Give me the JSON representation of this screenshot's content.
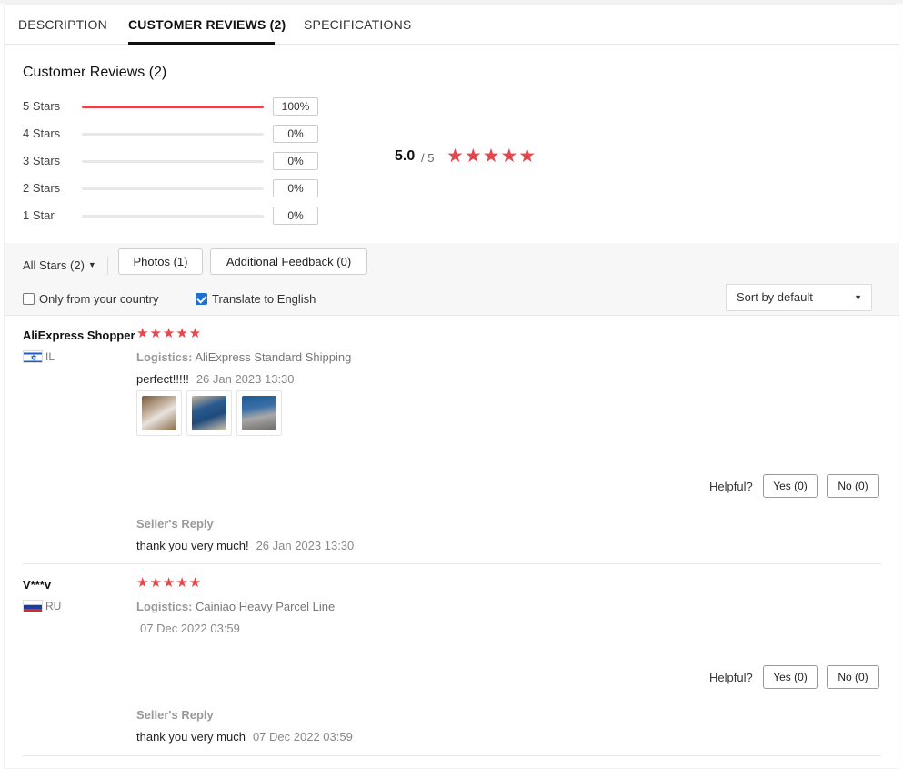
{
  "tabs": [
    {
      "label": "DESCRIPTION"
    },
    {
      "label": "CUSTOMER REVIEWS (2)"
    },
    {
      "label": "SPECIFICATIONS"
    }
  ],
  "summary": {
    "title": "Customer Reviews (2)",
    "distribution": [
      {
        "label": "5 Stars",
        "pct": "100%",
        "fill": 1.0
      },
      {
        "label": "4 Stars",
        "pct": "0%",
        "fill": 0
      },
      {
        "label": "3 Stars",
        "pct": "0%",
        "fill": 0
      },
      {
        "label": "2 Stars",
        "pct": "0%",
        "fill": 0
      },
      {
        "label": "1 Star",
        "pct": "0%",
        "fill": 0
      }
    ],
    "score": "5.0",
    "score_total": "/ 5",
    "stars": "★★★★★",
    "accent_color": "#e5474c"
  },
  "filters": {
    "all_stars": "All Stars (2)",
    "photos": "Photos (1)",
    "additional_feedback": "Additional Feedback (0)",
    "only_country": "Only from your country",
    "translate": "Translate to English",
    "translate_checked": true,
    "only_country_checked": false,
    "sort": "Sort by default"
  },
  "reviews": [
    {
      "name": "AliExpress Shopper",
      "country": "IL",
      "stars": "★★★★★",
      "logistics_label": "Logistics:",
      "logistics": "AliExpress Standard Shipping",
      "text": "perfect!!!!!",
      "date": "26 Jan 2023 13:30",
      "photos": 3,
      "helpful_label": "Helpful?",
      "yes": "Yes (0)",
      "no": "No (0)",
      "reply_title": "Seller's Reply",
      "reply_text": "thank you very much!",
      "reply_date": "26 Jan 2023 13:30"
    },
    {
      "name": "V***v",
      "country": "RU",
      "stars": "★★★★★",
      "logistics_label": "Logistics:",
      "logistics": "Cainiao Heavy Parcel Line",
      "text": "",
      "date": "07 Dec 2022 03:59",
      "photos": 0,
      "helpful_label": "Helpful?",
      "yes": "Yes (0)",
      "no": "No (0)",
      "reply_title": "Seller's Reply",
      "reply_text": "thank you very much",
      "reply_date": "07 Dec 2022 03:59"
    }
  ]
}
